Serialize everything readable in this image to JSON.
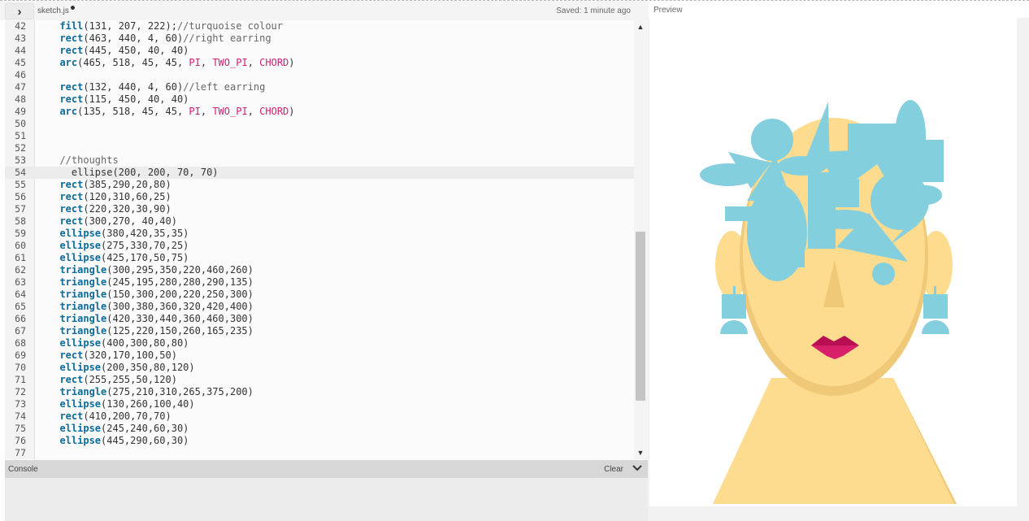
{
  "header": {
    "toggle_icon": "›",
    "file_name": "sketch.js",
    "saved_status": "Saved: 1 minute ago",
    "preview_label": "Preview"
  },
  "editor": {
    "active_line": 54,
    "lines": [
      {
        "n": "42",
        "tokens": [
          {
            "t": "  "
          },
          {
            "t": "fill",
            "c": "kw"
          },
          {
            "t": "(131, 207, 222);"
          },
          {
            "t": "//turquoise colour",
            "c": "cm"
          }
        ]
      },
      {
        "n": "43",
        "tokens": [
          {
            "t": "  "
          },
          {
            "t": "rect",
            "c": "kw"
          },
          {
            "t": "(463, 440, 4, 60)"
          },
          {
            "t": "//right earring",
            "c": "cm"
          }
        ]
      },
      {
        "n": "44",
        "tokens": [
          {
            "t": "  "
          },
          {
            "t": "rect",
            "c": "kw"
          },
          {
            "t": "(445, 450, 40, 40)"
          }
        ]
      },
      {
        "n": "45",
        "tokens": [
          {
            "t": "  "
          },
          {
            "t": "arc",
            "c": "kw"
          },
          {
            "t": "(465, 518, 45, 45, "
          },
          {
            "t": "PI",
            "c": "pk"
          },
          {
            "t": ", "
          },
          {
            "t": "TWO_PI",
            "c": "pk"
          },
          {
            "t": ", "
          },
          {
            "t": "CHORD",
            "c": "pk"
          },
          {
            "t": ")"
          }
        ]
      },
      {
        "n": "46",
        "tokens": []
      },
      {
        "n": "47",
        "tokens": [
          {
            "t": "  "
          },
          {
            "t": "rect",
            "c": "kw"
          },
          {
            "t": "(132, 440, 4, 60)"
          },
          {
            "t": "//left earring",
            "c": "cm"
          }
        ]
      },
      {
        "n": "48",
        "tokens": [
          {
            "t": "  "
          },
          {
            "t": "rect",
            "c": "kw"
          },
          {
            "t": "(115, 450, 40, 40)"
          }
        ]
      },
      {
        "n": "49",
        "tokens": [
          {
            "t": "  "
          },
          {
            "t": "arc",
            "c": "kw"
          },
          {
            "t": "(135, 518, 45, 45, "
          },
          {
            "t": "PI",
            "c": "pk"
          },
          {
            "t": ", "
          },
          {
            "t": "TWO_PI",
            "c": "pk"
          },
          {
            "t": ", "
          },
          {
            "t": "CHORD",
            "c": "pk"
          },
          {
            "t": ")"
          }
        ]
      },
      {
        "n": "50",
        "tokens": []
      },
      {
        "n": "51",
        "tokens": []
      },
      {
        "n": "52",
        "tokens": []
      },
      {
        "n": "53",
        "tokens": [
          {
            "t": "  "
          },
          {
            "t": "//thoughts",
            "c": "cm"
          }
        ]
      },
      {
        "n": "54",
        "tokens": [
          {
            "t": "    ellipse(200, 200, 70, 70)"
          }
        ]
      },
      {
        "n": "55",
        "tokens": [
          {
            "t": "  "
          },
          {
            "t": "rect",
            "c": "kw"
          },
          {
            "t": "(385,290,20,80)"
          }
        ]
      },
      {
        "n": "56",
        "tokens": [
          {
            "t": "  "
          },
          {
            "t": "rect",
            "c": "kw"
          },
          {
            "t": "(120,310,60,25)"
          }
        ]
      },
      {
        "n": "57",
        "tokens": [
          {
            "t": "  "
          },
          {
            "t": "rect",
            "c": "kw"
          },
          {
            "t": "(220,320,30,90)"
          }
        ]
      },
      {
        "n": "58",
        "tokens": [
          {
            "t": "  "
          },
          {
            "t": "rect",
            "c": "kw"
          },
          {
            "t": "(300,270, 40,40)"
          }
        ]
      },
      {
        "n": "59",
        "tokens": [
          {
            "t": "  "
          },
          {
            "t": "ellipse",
            "c": "kw"
          },
          {
            "t": "(380,420,35,35)"
          }
        ]
      },
      {
        "n": "60",
        "tokens": [
          {
            "t": "  "
          },
          {
            "t": "ellipse",
            "c": "kw"
          },
          {
            "t": "(275,330,70,25)"
          }
        ]
      },
      {
        "n": "61",
        "tokens": [
          {
            "t": "  "
          },
          {
            "t": "ellipse",
            "c": "kw"
          },
          {
            "t": "(425,170,50,75)"
          }
        ]
      },
      {
        "n": "62",
        "tokens": [
          {
            "t": "  "
          },
          {
            "t": "triangle",
            "c": "kw"
          },
          {
            "t": "(300,295,350,220,460,260)"
          }
        ]
      },
      {
        "n": "63",
        "tokens": [
          {
            "t": "  "
          },
          {
            "t": "triangle",
            "c": "kw"
          },
          {
            "t": "(245,195,280,280,290,135)"
          }
        ]
      },
      {
        "n": "64",
        "tokens": [
          {
            "t": "  "
          },
          {
            "t": "triangle",
            "c": "kw"
          },
          {
            "t": "(150,300,200,220,250,300)"
          }
        ]
      },
      {
        "n": "65",
        "tokens": [
          {
            "t": "  "
          },
          {
            "t": "triangle",
            "c": "kw"
          },
          {
            "t": "(300,380,360,320,420,400)"
          }
        ]
      },
      {
        "n": "66",
        "tokens": [
          {
            "t": "  "
          },
          {
            "t": "triangle",
            "c": "kw"
          },
          {
            "t": "(420,330,440,360,460,300)"
          }
        ]
      },
      {
        "n": "67",
        "tokens": [
          {
            "t": "  "
          },
          {
            "t": "triangle",
            "c": "kw"
          },
          {
            "t": "(125,220,150,260,165,235)"
          }
        ]
      },
      {
        "n": "68",
        "tokens": [
          {
            "t": "  "
          },
          {
            "t": "ellipse",
            "c": "kw"
          },
          {
            "t": "(400,300,80,80)"
          }
        ]
      },
      {
        "n": "69",
        "tokens": [
          {
            "t": "  "
          },
          {
            "t": "rect",
            "c": "kw"
          },
          {
            "t": "(320,170,100,50)"
          }
        ]
      },
      {
        "n": "70",
        "tokens": [
          {
            "t": "  "
          },
          {
            "t": "ellipse",
            "c": "kw"
          },
          {
            "t": "(200,350,80,120)"
          }
        ]
      },
      {
        "n": "71",
        "tokens": [
          {
            "t": "  "
          },
          {
            "t": "rect",
            "c": "kw"
          },
          {
            "t": "(255,255,50,120)"
          }
        ]
      },
      {
        "n": "72",
        "tokens": [
          {
            "t": "  "
          },
          {
            "t": "triangle",
            "c": "kw"
          },
          {
            "t": "(275,210,310,265,375,200)"
          }
        ]
      },
      {
        "n": "73",
        "tokens": [
          {
            "t": "  "
          },
          {
            "t": "ellipse",
            "c": "kw"
          },
          {
            "t": "(130,260,100,40)"
          }
        ]
      },
      {
        "n": "74",
        "tokens": [
          {
            "t": "  "
          },
          {
            "t": "rect",
            "c": "kw"
          },
          {
            "t": "(410,200,70,70)"
          }
        ]
      },
      {
        "n": "75",
        "tokens": [
          {
            "t": "  "
          },
          {
            "t": "ellipse",
            "c": "kw"
          },
          {
            "t": "(245,240,60,30)"
          }
        ]
      },
      {
        "n": "76",
        "tokens": [
          {
            "t": "  "
          },
          {
            "t": "ellipse",
            "c": "kw"
          },
          {
            "t": "(445,290,60,30)"
          }
        ]
      },
      {
        "n": "77",
        "tokens": []
      }
    ]
  },
  "console": {
    "title": "Console",
    "clear_label": "Clear",
    "chevron_icon": "chevron-down-icon"
  },
  "preview": {
    "colors": {
      "skin": "#fddc90",
      "skin_shadow": "#efc978",
      "turquoise": "#83cfde",
      "lips_dark": "#b80e52",
      "lips_light": "#d8206a"
    }
  }
}
